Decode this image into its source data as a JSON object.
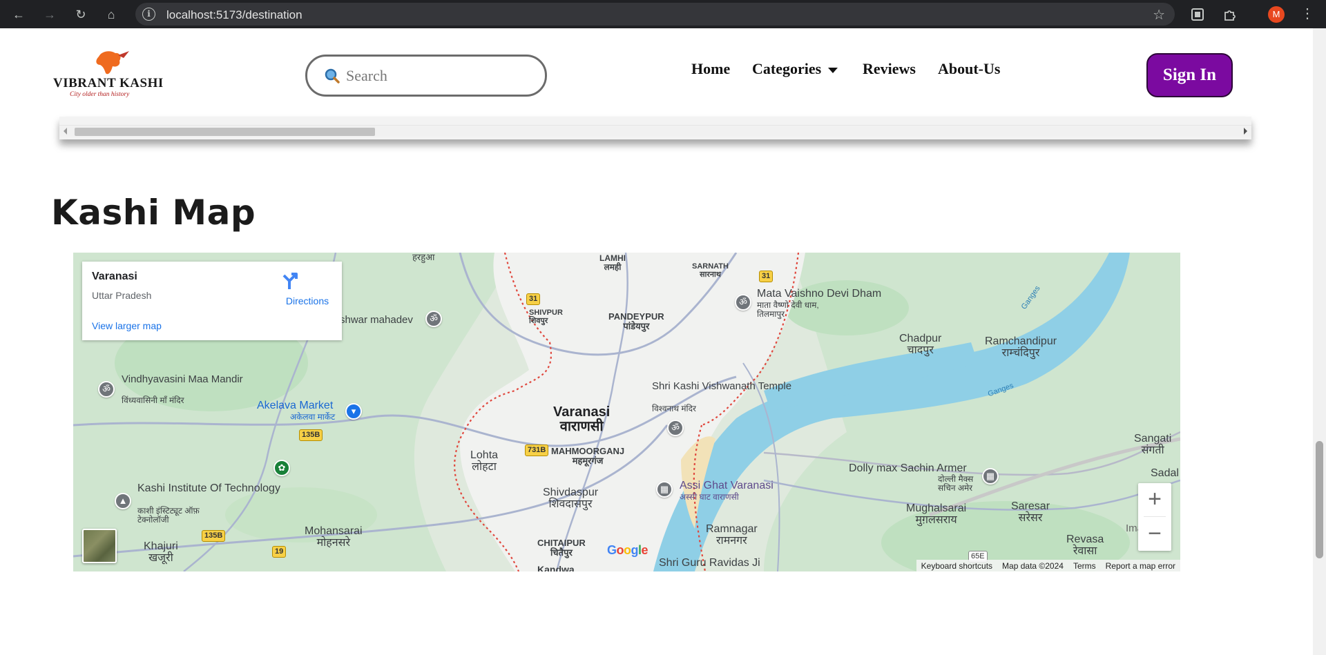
{
  "browser": {
    "url": "localhost:5173/destination",
    "profile_initial": "M"
  },
  "header": {
    "logo_text": "VIBRANT KASHI",
    "logo_tagline": "City older than history",
    "search_placeholder": "Search",
    "nav": {
      "home": "Home",
      "categories": "Categories",
      "reviews": "Reviews",
      "about": "About-Us"
    },
    "signin_label": "Sign In"
  },
  "section": {
    "title": "Kashi Map"
  },
  "map": {
    "card": {
      "place": "Varanasi",
      "region": "Uttar Pradesh",
      "directions": "Directions",
      "larger_map": "View larger map"
    },
    "labels": {
      "varanasi_en": "Varanasi",
      "varanasi_hi": "वाराणसी",
      "lamhi": "LAMHI",
      "lamhi_hi": "लमही",
      "sarnath": "SARNATH",
      "sarnath_hi": "सारनाथ",
      "pandeypur": "PANDEYPUR",
      "pandeypur_hi": "पांडेयपुर",
      "shivpur": "SHIVPUR",
      "shivpur_hi": "शिवपुर",
      "harhua": "हरहुआ",
      "mahadev": "shwar mahadev",
      "mata_vaishno": "Mata Vaishno Devi Dham",
      "mata_vaishno_hi": "माता वैष्णो देवी धाम, तिलमापुर",
      "chadpur": "Chadpur",
      "chadpur_hi": "चादपुर",
      "ramchandipur": "Ramchandipur",
      "ramchandipur_hi": "राम्चंदिपुर",
      "vindhyavasini": "Vindhyavasini Maa Mandir",
      "vindhyavasini_hi": "विंध्यवासिनी माँ मंदिर",
      "akelava": "Akelava Market",
      "akelava_hi": "अकेलवा मार्केट",
      "kashi_vishwanath": "Shri Kashi Vishwanath Temple",
      "kashi_vishwanath_hi": "विश्वनाथ मंदिर",
      "mahmoorganj": "MAHMOORGANJ",
      "mahmoorganj_hi": "महमूरगंज",
      "lohta": "Lohta",
      "lohta_hi": "लोहटा",
      "shivdaspur": "Shivdaspur",
      "shivdaspur_hi": "शिवदासपुर",
      "assi_ghat": "Assi Ghat Varanasi",
      "assi_ghat_hi": "अस्सी घाट वाराणसी",
      "kashi_institute": "Kashi Institute Of Technology",
      "kashi_institute_hi": "काशी इंस्टिट्यूट ऑफ़ टेक्नोलॉजी",
      "mohansarai": "Mohansarai",
      "mohansarai_hi": "मोहनसरे",
      "khajuri": "Khajuri",
      "khajuri_hi": "खजूरी",
      "chitaipur": "CHITAIPUR",
      "chitaipur_hi": "चितैपुर",
      "ramnagar": "Ramnagar",
      "ramnagar_hi": "रामनगर",
      "guru_ravidas": "Shri Guru Ravidas Ji",
      "kandwa": "Kandwa",
      "dolly": "Dolly max Sachin Armer",
      "dolly_hi": "दोल्ली मैक्स सचिन अमेर",
      "mughalsarai": "Mughalsarai",
      "mughalsarai_hi": "मुग़लसराय",
      "saresar": "Saresar",
      "saresar_hi": "सरेसर",
      "sangati": "Sangati",
      "sangati_hi": "संगती",
      "sadal": "Sadal",
      "revasa": "Revasa",
      "revasa_hi": "रेवासा",
      "ganges_1": "Ganges",
      "ganges_2": "Ganges",
      "ima": "Ima"
    },
    "shields": {
      "r31a": "31",
      "r31b": "31",
      "r135b_a": "135B",
      "r135b_b": "135B",
      "r731b": "731B",
      "r19": "19",
      "r65e": "65E"
    },
    "footer": {
      "shortcuts": "Keyboard shortcuts",
      "data": "Map data ©2024",
      "terms": "Terms",
      "report": "Report a map error"
    },
    "google": "Google"
  },
  "colors": {
    "signin_bg": "#7b0aa0",
    "water": "#8fcfe6",
    "greenery": "#c8e6c9",
    "link_blue": "#1a73e8"
  }
}
